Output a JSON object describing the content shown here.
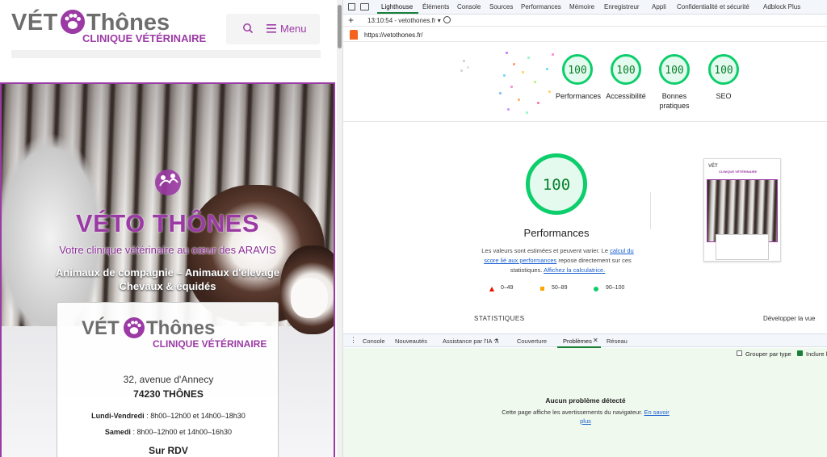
{
  "site": {
    "logo": {
      "part1": "VÉT",
      "part2": "Thônes",
      "subtitle": "CLINIQUE VÉTÉRINAIRE"
    },
    "menu_label": "Menu",
    "hero": {
      "title": "VÉTO THÔNES",
      "subtitle": "Votre clinique vétérinaire au cœur des ARAVIS",
      "line1": "Animaux de compagnie – Animaux d'élevage",
      "line2": "Chevaux & équidés"
    },
    "card": {
      "address_line1": "32, avenue d'Annecy",
      "address_line2": "74230 THÔNES",
      "hours_weekday_label": "Lundi-Vendredi",
      "hours_weekday": " : 8h00–12h00 et 14h00–18h30",
      "hours_saturday_label": "Samedi",
      "hours_saturday": " : 8h00–12h00 et 14h00–16h30",
      "rdv": "Sur RDV"
    }
  },
  "devtools": {
    "tabs": [
      "Lighthouse",
      "Éléments",
      "Console",
      "Sources",
      "Performances",
      "Mémoire",
      "Enregistreur",
      "Appli",
      "Confidentialité et sécurité",
      "Adblock Plus"
    ],
    "session": "13:10:54 - vetothones.fr",
    "url": "https://vetothones.fr/",
    "scores": [
      {
        "label": "Performances",
        "value": "100"
      },
      {
        "label": "Accessibilité",
        "value": "100"
      },
      {
        "label": "Bonnes pratiques",
        "value": "100"
      },
      {
        "label": "SEO",
        "value": "100"
      }
    ],
    "main_score": "100",
    "main_title": "Performances",
    "desc_before": "Les valeurs sont estimées et peuvent varier. Le ",
    "desc_link1": "calcul du score lié aux performances",
    "desc_middle": " repose directement sur ces statistiques. ",
    "desc_link2": "Affichez la calculatrice.",
    "legend": [
      {
        "range": "0–49",
        "color": "#eb0f00"
      },
      {
        "range": "50–89",
        "color": "#ffa400"
      },
      {
        "range": "90–100",
        "color": "#0cce6b"
      }
    ],
    "stats_label": "STATISTIQUES",
    "expand_label": "Développer la vue",
    "drawer_tabs": [
      "Console",
      "Nouveautés",
      "Assistance par l'IA",
      "Couverture",
      "Problèmes",
      "Réseau"
    ],
    "group_by_type": "Grouper par type",
    "include_label": "Inclure l",
    "no_problem_title": "Aucun problème détecté",
    "no_problem_desc": "Cette page affiche les avertissements du navigateur.",
    "learn_more": "En savoir plus"
  }
}
